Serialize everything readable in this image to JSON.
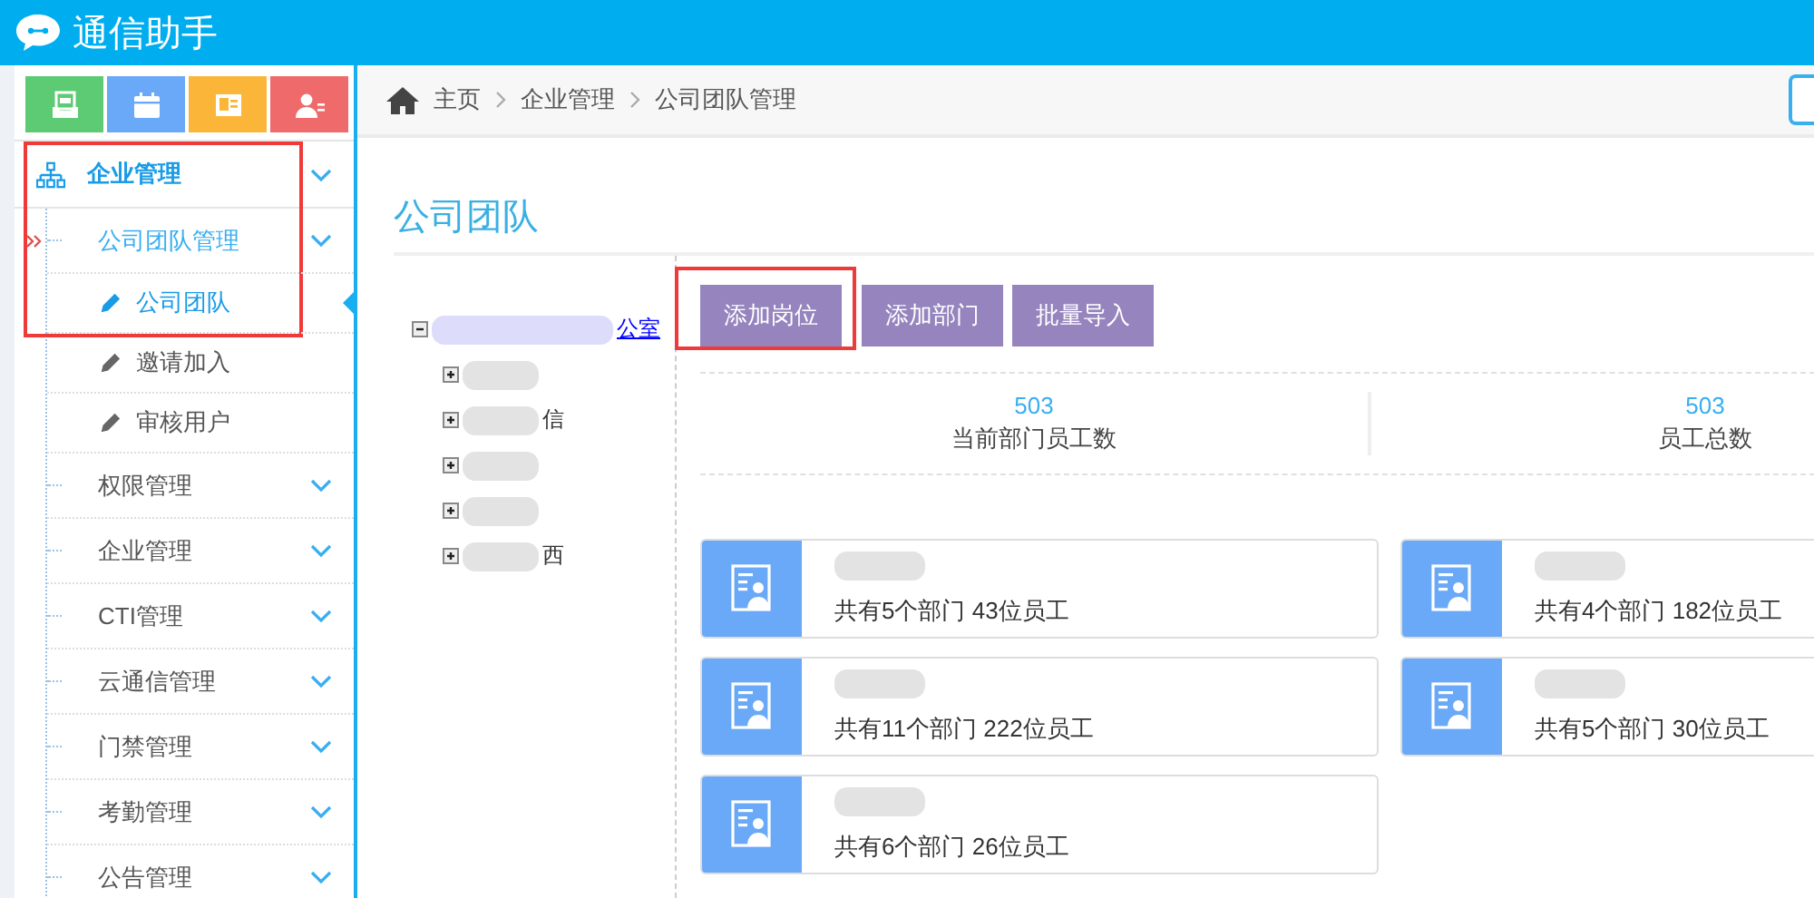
{
  "app": {
    "title": "通信助手"
  },
  "quick_buttons": [
    {
      "kind": "inbox",
      "color": "#5ccb73"
    },
    {
      "kind": "calendar",
      "color": "#6aa9f7"
    },
    {
      "kind": "card",
      "color": "#fbb63a"
    },
    {
      "kind": "contact",
      "color": "#ef6b6b"
    }
  ],
  "sidebar": {
    "highlighted": true,
    "group": {
      "label": "企业管理",
      "expanded": true,
      "children": [
        {
          "label": "公司团队管理",
          "selected": true,
          "expanded": true,
          "children": [
            {
              "label": "公司团队",
              "selected": true
            },
            {
              "label": "邀请加入",
              "selected": false
            },
            {
              "label": "审核用户",
              "selected": false
            }
          ]
        },
        {
          "label": "权限管理",
          "selected": false
        },
        {
          "label": "企业管理",
          "selected": false
        },
        {
          "label": "CTI管理",
          "selected": false
        },
        {
          "label": "云通信管理",
          "selected": false
        },
        {
          "label": "门禁管理",
          "selected": false
        },
        {
          "label": "考勤管理",
          "selected": false
        },
        {
          "label": "公告管理",
          "selected": false
        }
      ]
    }
  },
  "breadcrumb": [
    "主页",
    "企业管理",
    "公司团队管理"
  ],
  "page_title": "公司团队",
  "tree": {
    "text": "公室",
    "expanded": true,
    "children": [
      {
        "expanded": false
      },
      {
        "text": "信",
        "expanded": false
      },
      {
        "expanded": false
      },
      {
        "expanded": false
      },
      {
        "text": "西",
        "expanded": false
      }
    ]
  },
  "buttons": [
    {
      "label": "添加岗位",
      "highlighted": true
    },
    {
      "label": "添加部门",
      "highlighted": false
    },
    {
      "label": "批量导入",
      "highlighted": false
    }
  ],
  "stats": [
    {
      "value": "503",
      "label": "当前部门员工数"
    },
    {
      "value": "503",
      "label": "员工总数"
    }
  ],
  "cards": [
    {
      "summary": "共有5个部门 43位员工"
    },
    {
      "summary": "共有4个部门 182位员工"
    },
    {
      "summary": "共有11个部门 222位员工"
    },
    {
      "summary": "共有5个部门 30位员工"
    },
    {
      "summary": "共有6个部门 26位员工"
    }
  ]
}
